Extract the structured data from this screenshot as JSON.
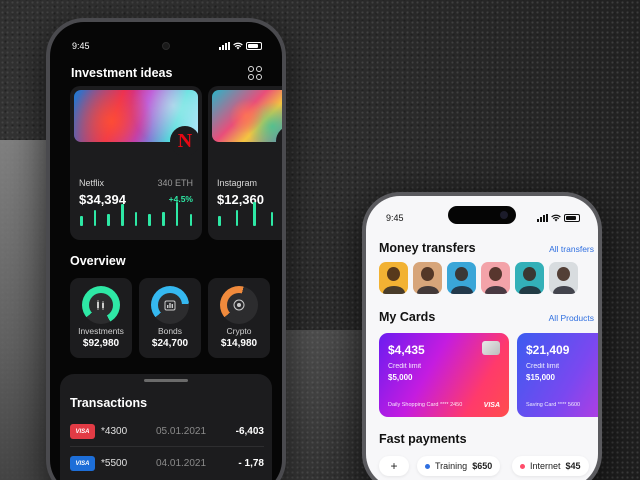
{
  "dark_phone": {
    "status_time": "9:45",
    "investment": {
      "title": "Investment ideas",
      "cards": [
        {
          "name": "Netflix",
          "eth": "340 ETH",
          "price": "$34,394",
          "change": "+4.5%",
          "logo": "netflix-logo"
        },
        {
          "name": "Instagram",
          "price": "$12,360",
          "logo": "instagram-logo"
        }
      ]
    },
    "overview": {
      "title": "Overview",
      "items": [
        {
          "label": "Investments",
          "value": "$92,980",
          "icon": "chart-candle-icon",
          "color": "#2ee8a5"
        },
        {
          "label": "Bonds",
          "value": "$24,700",
          "icon": "bar-chart-icon",
          "color": "#35b8f0"
        },
        {
          "label": "Crypto",
          "value": "$14,980",
          "icon": "coin-icon",
          "color": "#f08a3c"
        }
      ]
    },
    "transactions": {
      "title": "Transactions",
      "rows": [
        {
          "brand": "VISA",
          "card": "*4300",
          "date": "05.01.2021",
          "amount": "-6,403"
        },
        {
          "brand": "VISA",
          "card": "*5500",
          "date": "04.01.2021",
          "amount": "- 1,78"
        }
      ]
    }
  },
  "light_phone": {
    "status_time": "9:45",
    "transfers": {
      "title": "Money transfers",
      "link": "All transfers"
    },
    "cards_section": {
      "title": "My Cards",
      "link": "All Products",
      "cards": [
        {
          "balance": "$4,435",
          "limit_label": "Credit limit",
          "limit": "$5,000",
          "type": "Daily Shopping Card  **** 2450",
          "brand": "VISA"
        },
        {
          "balance": "$21,409",
          "limit_label": "Credit limit",
          "limit": "$15,000",
          "type": "Saving Card  **** 5600"
        }
      ]
    },
    "fast_payments": {
      "title": "Fast payments",
      "add": "+",
      "items": [
        {
          "label": "Training",
          "amount": "$650",
          "color": "#2f6fe0"
        },
        {
          "label": "Internet",
          "amount": "$45",
          "color": "#ff4d6a"
        }
      ]
    }
  },
  "colors": {
    "accent_green": "#2ee8a5",
    "link_blue": "#2f6fe0"
  }
}
